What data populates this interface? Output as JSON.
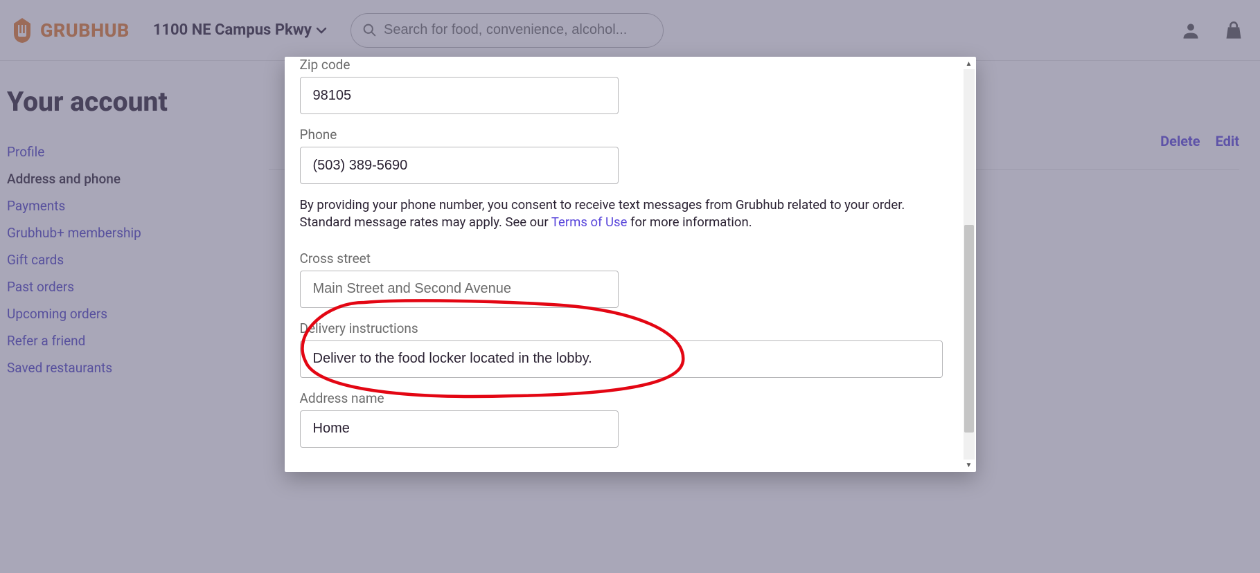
{
  "header": {
    "address": "1100 NE Campus Pkwy",
    "search_placeholder": "Search for food, convenience, alcohol..."
  },
  "sidebar": {
    "title": "Your account",
    "items": [
      {
        "label": "Profile",
        "active": false
      },
      {
        "label": "Address and phone",
        "active": true
      },
      {
        "label": "Payments",
        "active": false
      },
      {
        "label": "Grubhub+ membership",
        "active": false
      },
      {
        "label": "Gift cards",
        "active": false
      },
      {
        "label": "Past orders",
        "active": false
      },
      {
        "label": "Upcoming orders",
        "active": false
      },
      {
        "label": "Refer a friend",
        "active": false
      },
      {
        "label": "Saved restaurants",
        "active": false
      }
    ]
  },
  "content": {
    "delete_label": "Delete",
    "edit_label": "Edit"
  },
  "modal": {
    "zip_label": "Zip code",
    "zip_value": "98105",
    "phone_label": "Phone",
    "phone_value": "(503) 389-5690",
    "phone_note_pre": "By providing your phone number, you consent to receive text messages from Grubhub related to your order. Standard message rates may apply. See our ",
    "phone_note_link": "Terms of Use",
    "phone_note_post": " for more information.",
    "cross_label": "Cross street",
    "cross_placeholder": "Main Street and Second Avenue",
    "cross_value": "",
    "delivery_label": "Delivery instructions",
    "delivery_value": "Deliver to the food locker located in the lobby.",
    "name_label": "Address name",
    "name_value": "Home"
  }
}
